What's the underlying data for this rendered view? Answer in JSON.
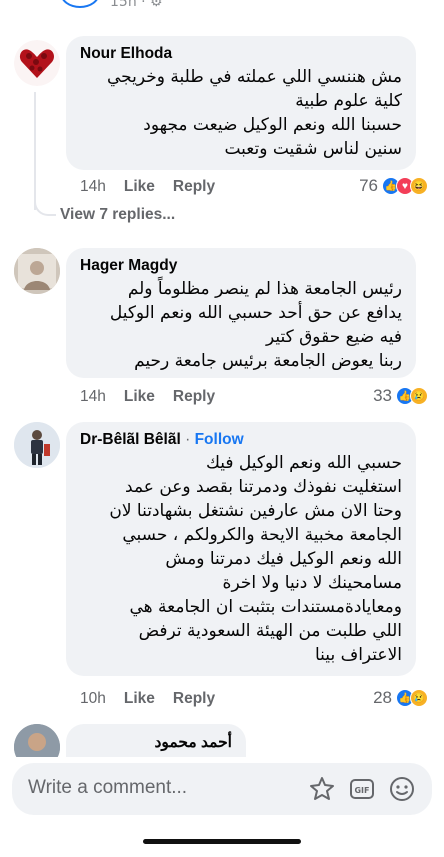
{
  "header": {
    "meta_text": "15h · ⚙"
  },
  "comments": [
    {
      "author": "Nour Elhoda",
      "lines": [
        "مش هننسي اللي عملته في طلبة وخريجي",
        "كلية علوم طبية",
        "حسبنا الله ونعم الوكيل ضيعت مجهود",
        "سنين لناس شقيت وتعبت"
      ],
      "time": "14h",
      "like": "Like",
      "reply": "Reply",
      "reaction_count": "76",
      "reactions": [
        "like-reaction-icon",
        "love-reaction-icon",
        "haha-reaction-icon"
      ]
    },
    {
      "author": "Hager Magdy",
      "lines": [
        "رئيس الجامعة هذا لم ينصر مظلوماً ولم",
        "يدافع عن حق أحد حسبي الله ونعم الوكيل",
        "فيه ضيع حقوق كتير",
        "ربنا يعوض الجامعة برئيس جامعة رحيم"
      ],
      "time": "14h",
      "like": "Like",
      "reply": "Reply",
      "reaction_count": "33",
      "reactions": [
        "like-reaction-icon",
        "sad-reaction-icon"
      ]
    },
    {
      "author": "Dr-Bêlãl Bêlãl",
      "separator": " · ",
      "follow": "Follow",
      "lines": [
        "حسبي الله ونعم الوكيل فيك",
        "استغليت نفوذك ودمرتنا بقصد وعن عمد",
        "وحتا الان مش عارفين نشتغل بشهادتنا لان",
        "الجامعة مخبية الايحة والكرولكم ، حسبي",
        "الله ونعم الوكيل فيك دمرتنا ومش",
        "مسامحينك لا دنيا ولا اخرة",
        "ومعايادةمستندات بتثبت ان الجامعة هي",
        "اللي طلبت من الهيئة السعودية ترفض",
        "الاعتراف بينا"
      ],
      "time": "10h",
      "like": "Like",
      "reply": "Reply",
      "reaction_count": "28",
      "reactions": [
        "like-reaction-icon",
        "sad-reaction-icon"
      ]
    },
    {
      "author": "أحمد محمود"
    }
  ],
  "view_replies": "View 7 replies...",
  "composer": {
    "placeholder": "Write a comment..."
  },
  "colors": {
    "accent": "#1877f2",
    "bubble": "#f0f2f5",
    "muted": "#65676b"
  }
}
